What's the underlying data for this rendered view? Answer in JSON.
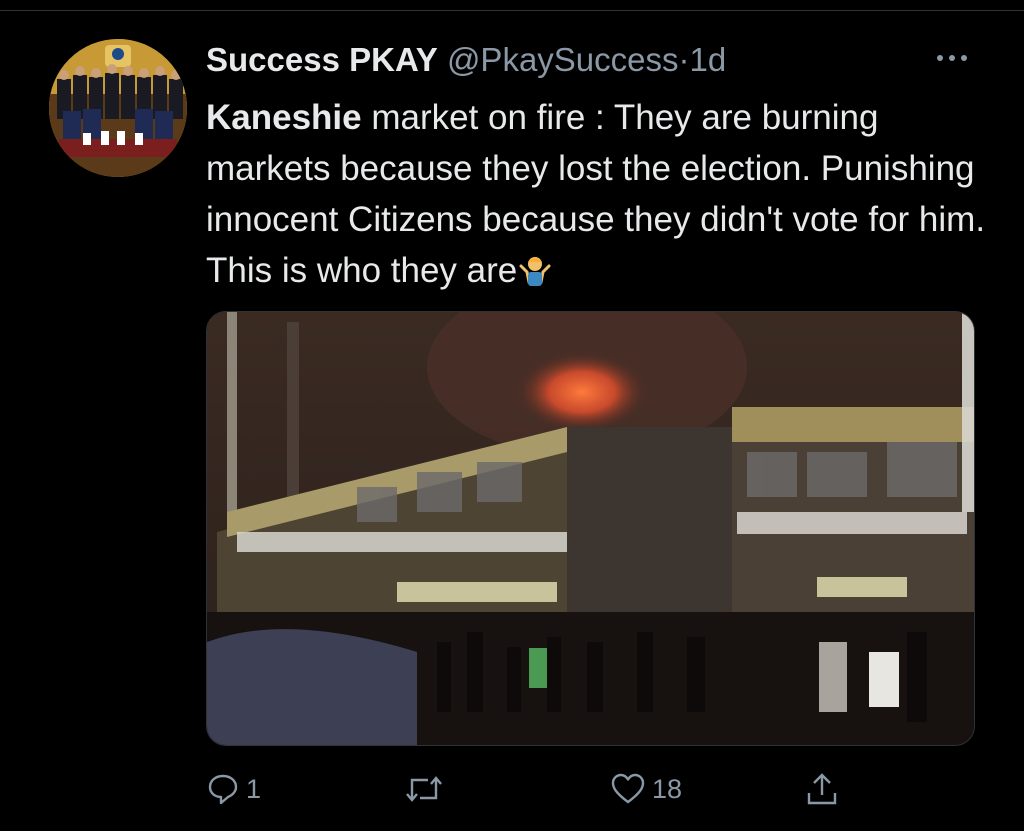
{
  "tweet": {
    "display_name": "Success PKAY",
    "handle": "@PkaySuccess",
    "separator": "·",
    "time": "1d",
    "more_icon": "ellipsis-icon",
    "text_bold": "Kaneshie",
    "text_rest": " market on fire : They are burning markets because they lost the election. Punishing innocent Citizens because they didn't vote for him. This is who they are",
    "emoji": "man-shrugging-emoji",
    "media": {
      "kind": "photo",
      "subject": "market building on fire at night"
    }
  },
  "actions": {
    "reply": {
      "icon": "reply-icon",
      "count": "1"
    },
    "retweet": {
      "icon": "retweet-icon",
      "count": ""
    },
    "like": {
      "icon": "heart-icon",
      "count": "18"
    },
    "share": {
      "icon": "share-icon"
    }
  },
  "colors": {
    "background": "#000000",
    "text": "#e7e9ea",
    "secondary": "#8b98a5"
  }
}
